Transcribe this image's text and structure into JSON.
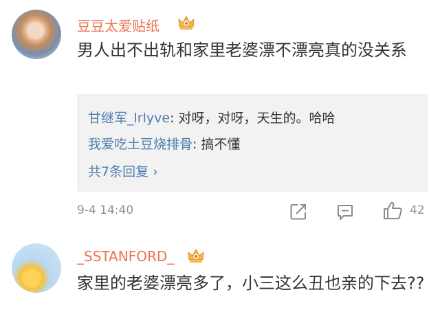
{
  "comments": [
    {
      "username": "豆豆太爱贴纸",
      "content": "男人出不出轨和家里老婆漂不漂亮真的没关系",
      "replies": [
        {
          "name": "甘继军_lrlyve",
          "text": ": 对呀，对呀，天生的。哈哈"
        },
        {
          "name": "我爱吃土豆烧排骨",
          "text": ": 搞不懂"
        }
      ],
      "more_replies": "共7条回复 ›",
      "date": "9-4 14:40",
      "like_count": "42"
    },
    {
      "username": "_SSTANFORD_",
      "content": "家里的老婆漂亮多了，小三这么丑也亲的下去??"
    }
  ],
  "colors": {
    "username": "#eb7350",
    "reply_name": "#507daf",
    "reply_bg": "#f2f2f2",
    "vip_badge": "#f4b64a"
  },
  "icons": [
    "crown-vip-icon",
    "share-icon",
    "comment-icon",
    "like-icon"
  ]
}
